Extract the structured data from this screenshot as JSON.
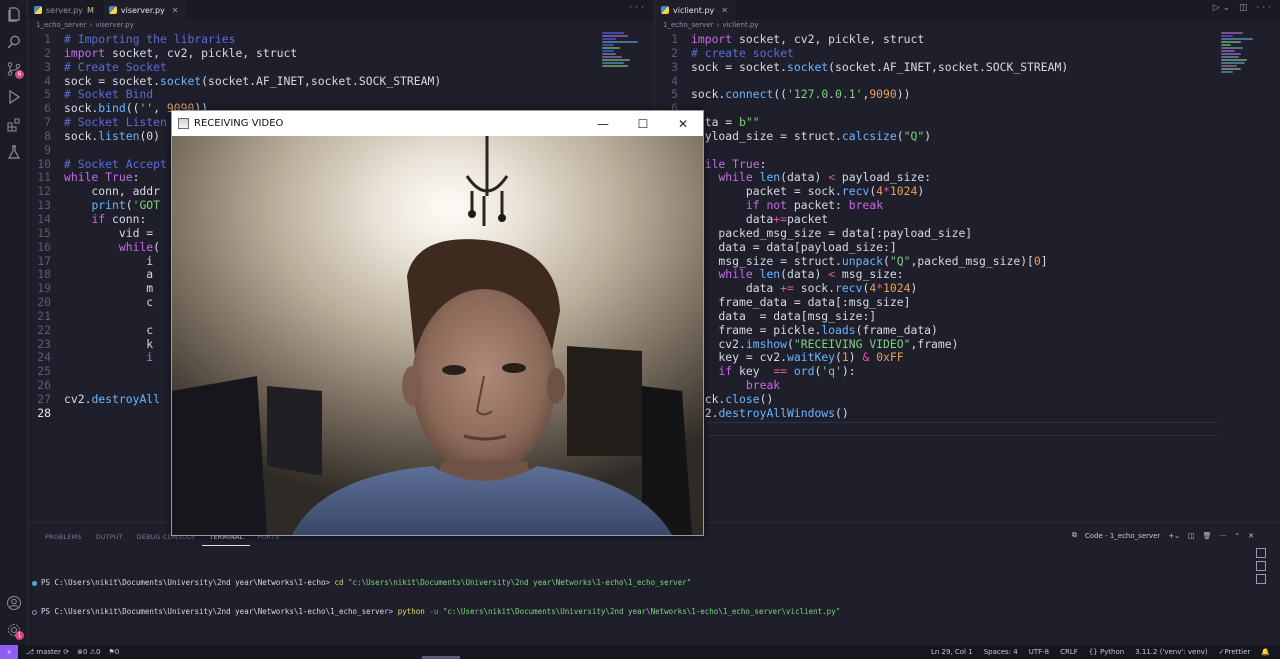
{
  "colors": {
    "accent": "#8f5cf5",
    "badge": "#d9467a",
    "background": "#1e1f2b"
  },
  "activity_bar": {
    "icons": [
      "explorer-icon",
      "search-icon",
      "source-control-icon",
      "run-debug-icon",
      "extensions-icon",
      "testing-icon",
      "account-icon",
      "settings-gear-icon"
    ],
    "source_control_badge": "6",
    "settings_badge": "1"
  },
  "left_editor": {
    "tabs": [
      {
        "label": "server.py",
        "modified": "M",
        "active": false
      },
      {
        "label": "viserver.py",
        "active": true
      }
    ],
    "breadcrumb": [
      "1_echo_server",
      "viserver.py"
    ],
    "lines": [
      {
        "n": "1",
        "html": "<span class='cm'># Importing the libraries</span>"
      },
      {
        "n": "2",
        "html": "<span class='kw'>import</span> socket, cv2, pickle, struct"
      },
      {
        "n": "3",
        "html": "<span class='cm'># Create Socket</span>"
      },
      {
        "n": "4",
        "html": "sock = socket.<span class='fn'>socket</span>(socket.AF_INET,socket.SOCK_STREAM)"
      },
      {
        "n": "5",
        "html": "<span class='cm'># Socket Bind</span>"
      },
      {
        "n": "6",
        "html": "sock.<span class='fn'>bind</span>((<span class='st'>''</span>, <span class='nm'>9090</span>))"
      },
      {
        "n": "7",
        "html": "<span class='cm'># Socket Listen</span>"
      },
      {
        "n": "8",
        "html": "sock.<span class='fn'>listen</span>(0)"
      },
      {
        "n": "9",
        "html": ""
      },
      {
        "n": "10",
        "html": "<span class='cm'># Socket Accept</span>"
      },
      {
        "n": "11",
        "html": "<span class='kw'>while</span> <span class='kw'>True</span>:"
      },
      {
        "n": "12",
        "html": "    conn, addr"
      },
      {
        "n": "13",
        "html": "    <span class='fn'>print</span>(<span class='st'>'GOT</span>"
      },
      {
        "n": "14",
        "html": "    <span class='kw'>if</span> conn:"
      },
      {
        "n": "15",
        "html": "        vid ="
      },
      {
        "n": "16",
        "html": "        <span class='kw'>while</span>("
      },
      {
        "n": "17",
        "html": "            i"
      },
      {
        "n": "18",
        "html": "            a"
      },
      {
        "n": "19",
        "html": "            m"
      },
      {
        "n": "20",
        "html": "            c"
      },
      {
        "n": "21",
        "html": ""
      },
      {
        "n": "22",
        "html": "            c"
      },
      {
        "n": "23",
        "html": "            k"
      },
      {
        "n": "24",
        "html": "            <span class='kw'>i</span>"
      },
      {
        "n": "25",
        "html": ""
      },
      {
        "n": "26",
        "html": ""
      },
      {
        "n": "27",
        "html": "cv2.<span class='fn'>destroyAll</span>"
      },
      {
        "n": "28",
        "html": ""
      }
    ]
  },
  "right_editor": {
    "tabs": [
      {
        "label": "viclient.py",
        "active": true
      }
    ],
    "breadcrumb": [
      "1_echo_server",
      "viclient.py"
    ],
    "lines": [
      {
        "n": "1",
        "html": "<span class='kw'>import</span> socket, cv2, pickle, struct"
      },
      {
        "n": "2",
        "html": "<span class='cm'># create socket</span>"
      },
      {
        "n": "3",
        "html": "sock = socket.<span class='fn'>socket</span>(socket.AF_INET,socket.SOCK_STREAM)"
      },
      {
        "n": "4",
        "html": ""
      },
      {
        "n": "5",
        "html": "sock.<span class='fn'>connect</span>((<span class='st'>'127.0.0.1'</span>,<span class='nm'>9090</span>))"
      },
      {
        "n": "6",
        "html": ""
      },
      {
        "n": "7",
        "html": "data = <span class='st'>b\"\"</span>"
      },
      {
        "n": "8",
        "html": "payload_size = struct.<span class='fn'>calcsize</span>(<span class='st'>\"Q\"</span>)"
      },
      {
        "n": "9",
        "html": ""
      },
      {
        "n": "10",
        "html": "<span class='kw'>while</span> <span class='kw'>True</span>:"
      },
      {
        "n": "11",
        "html": "    <span class='kw'>while</span> <span class='fn'>len</span>(data) <span class='op'>&lt;</span> payload_size:"
      },
      {
        "n": "12",
        "html": "        packet = sock.<span class='fn'>recv</span>(<span class='nm'>4</span><span class='op'>*</span><span class='nm'>1024</span>)"
      },
      {
        "n": "13",
        "html": "        <span class='kw'>if</span> <span class='kw'>not</span> packet: <span class='kw'>break</span>"
      },
      {
        "n": "14",
        "html": "        data<span class='op'>+=</span>packet"
      },
      {
        "n": "15",
        "html": "    packed_msg_size = data[:payload_size]"
      },
      {
        "n": "16",
        "html": "    data = data[payload_size:]"
      },
      {
        "n": "17",
        "html": "    msg_size = struct.<span class='fn'>unpack</span>(<span class='st'>\"Q\"</span>,packed_msg_size)[<span class='nm'>0</span>]"
      },
      {
        "n": "18",
        "html": "    <span class='kw'>while</span> <span class='fn'>len</span>(data) <span class='op'>&lt;</span> msg_size:"
      },
      {
        "n": "19",
        "html": "        data <span class='op'>+=</span> sock.<span class='fn'>recv</span>(<span class='nm'>4</span><span class='op'>*</span><span class='nm'>1024</span>)"
      },
      {
        "n": "20",
        "html": "    frame_data = data[:msg_size]"
      },
      {
        "n": "21",
        "html": "    data  = data[msg_size:]"
      },
      {
        "n": "22",
        "html": "    frame = pickle.<span class='fn'>loads</span>(frame_data)"
      },
      {
        "n": "23",
        "html": "    cv2.<span class='fn'>imshow</span>(<span class='st'>\"RECEIVING VIDEO\"</span>,frame)"
      },
      {
        "n": "24",
        "html": "    key = cv2.<span class='fn'>waitKey</span>(<span class='nm'>1</span>) <span class='op'>&amp;</span> <span class='nm'>0xFF</span>"
      },
      {
        "n": "25",
        "html": "    <span class='kw'>if</span> key  <span class='op'>==</span> <span class='fn'>ord</span>(<span class='st'>'q'</span>):"
      },
      {
        "n": "26",
        "html": "        <span class='kw'>break</span>"
      },
      {
        "n": "27",
        "html": "sock.<span class='fn'>close</span>()"
      },
      {
        "n": "28",
        "html": "cv2.<span class='fn'>destroyAllWindows</span>()"
      },
      {
        "n": "29",
        "html": ""
      }
    ]
  },
  "video_window": {
    "title": "RECEIVING VIDEO",
    "minimize": "—",
    "maximize": "☐",
    "close": "✕"
  },
  "panel": {
    "tabs": [
      "PROBLEMS",
      "OUTPUT",
      "DEBUG CONSOLE",
      "TERMINAL",
      "PORTS"
    ],
    "active_tab": "TERMINAL",
    "terminal_name": "Code - 1_echo_server",
    "terminal_lines": [
      {
        "prompt": "PS C:\\Users\\nikit\\Documents\\University\\2nd year\\Networks\\1-echo>",
        "cmd": "cd",
        "flag": "",
        "arg": "\"c:\\Users\\nikit\\Documents\\University\\2nd year\\Networks\\1-echo\\1_echo_server\""
      },
      {
        "prompt": "PS C:\\Users\\nikit\\Documents\\University\\2nd year\\Networks\\1-echo\\1_echo_server>",
        "cmd": "python",
        "flag": "-u",
        "arg": "\"c:\\Users\\nikit\\Documents\\University\\2nd year\\Networks\\1-echo\\1_echo_server\\viclient.py\""
      }
    ]
  },
  "status_bar": {
    "branch": "master",
    "errors": "0",
    "warnings": "0",
    "ports": "0",
    "position": "Ln 29, Col 1",
    "spaces": "Spaces: 4",
    "encoding": "UTF-8",
    "eol": "CRLF",
    "language": "Python",
    "interpreter": "3.11.2 ('venv': venv)",
    "formatter": "Prettier"
  }
}
